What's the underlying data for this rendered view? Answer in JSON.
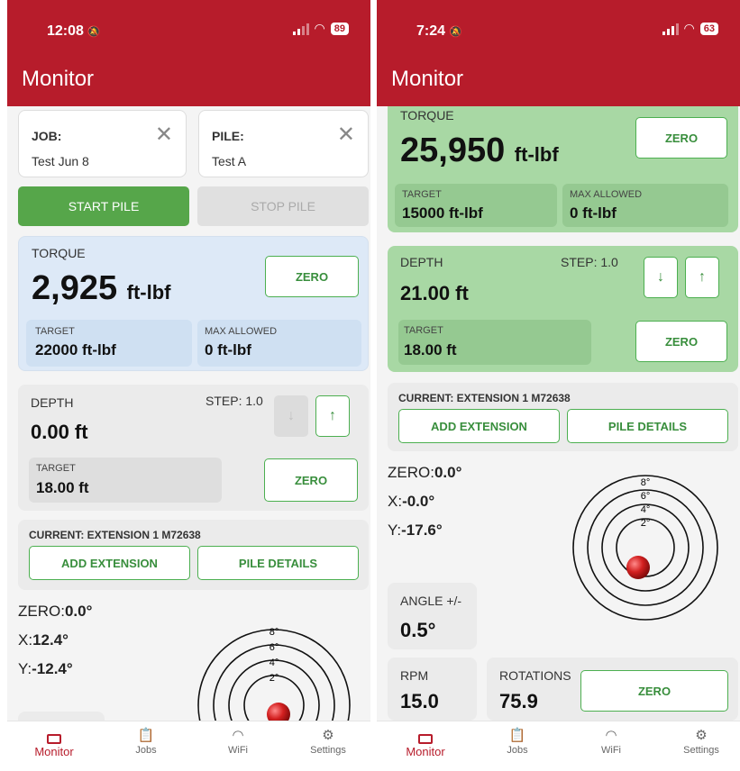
{
  "left": {
    "status": {
      "time": "12:08",
      "battery": "89"
    },
    "app_title": "Monitor",
    "job": {
      "label": "JOB:",
      "value": "Test Jun 8"
    },
    "pile": {
      "label": "PILE:",
      "value": "Test A"
    },
    "start_label": "START PILE",
    "stop_label": "STOP PILE",
    "torque": {
      "label": "TORQUE",
      "value": "2,925",
      "unit": "ft-lbf",
      "zero": "ZERO",
      "target_label": "TARGET",
      "target_value": "22000 ft-lbf",
      "max_label": "MAX ALLOWED",
      "max_value": "0 ft-lbf"
    },
    "depth": {
      "label": "DEPTH",
      "step": "STEP: 1.0",
      "value": "0.00 ft",
      "target_label": "TARGET",
      "target_value": "18.00 ft",
      "zero": "ZERO"
    },
    "extension": {
      "current": "CURRENT: EXTENSION 1 M72638",
      "add": "ADD EXTENSION",
      "details": "PILE DETAILS"
    },
    "tilt": {
      "zero_label": "ZERO:",
      "zero_value": "0.0°",
      "x_label": "X:",
      "x_value": "12.4°",
      "y_label": "Y:",
      "y_value": "-12.4°"
    },
    "rings": [
      "8°",
      "6°",
      "4°",
      "2°"
    ]
  },
  "right": {
    "status": {
      "time": "7:24",
      "battery": "63"
    },
    "app_title": "Monitor",
    "torque": {
      "label": "TORQUE",
      "value": "25,950",
      "unit": "ft-lbf",
      "zero": "ZERO",
      "target_label": "TARGET",
      "target_value": "15000 ft-lbf",
      "max_label": "MAX ALLOWED",
      "max_value": "0 ft-lbf"
    },
    "depth": {
      "label": "DEPTH",
      "step": "STEP: 1.0",
      "value": "21.00 ft",
      "target_label": "TARGET",
      "target_value": "18.00 ft",
      "zero": "ZERO"
    },
    "extension": {
      "current": "CURRENT: EXTENSION 1 M72638",
      "add": "ADD EXTENSION",
      "details": "PILE DETAILS"
    },
    "tilt": {
      "zero_label": "ZERO:",
      "zero_value": "0.0°",
      "x_label": "X:",
      "x_value": "-0.0°",
      "y_label": "Y:",
      "y_value": "-17.6°"
    },
    "rings": [
      "8°",
      "6°",
      "4°",
      "2°"
    ],
    "angle": {
      "label": "ANGLE +/-",
      "value": "0.5°"
    },
    "rpm": {
      "label": "RPM",
      "value": "15.0"
    },
    "rotations": {
      "label": "ROTATIONS",
      "value": "75.9",
      "zero": "ZERO"
    }
  },
  "tabs": [
    "Monitor",
    "Jobs",
    "WiFi",
    "Settings"
  ],
  "icons": {
    "bell": "bell-slash-icon",
    "monitor": "monitor-icon",
    "jobs": "clipboard-icon",
    "wifi": "wifi-icon",
    "settings": "gear-icon"
  },
  "colors": {
    "brand": "#b71c2b",
    "accent_green": "#4caf50",
    "torque_ok": "#dde9f7",
    "torque_exceeded": "#a8d8a4"
  }
}
